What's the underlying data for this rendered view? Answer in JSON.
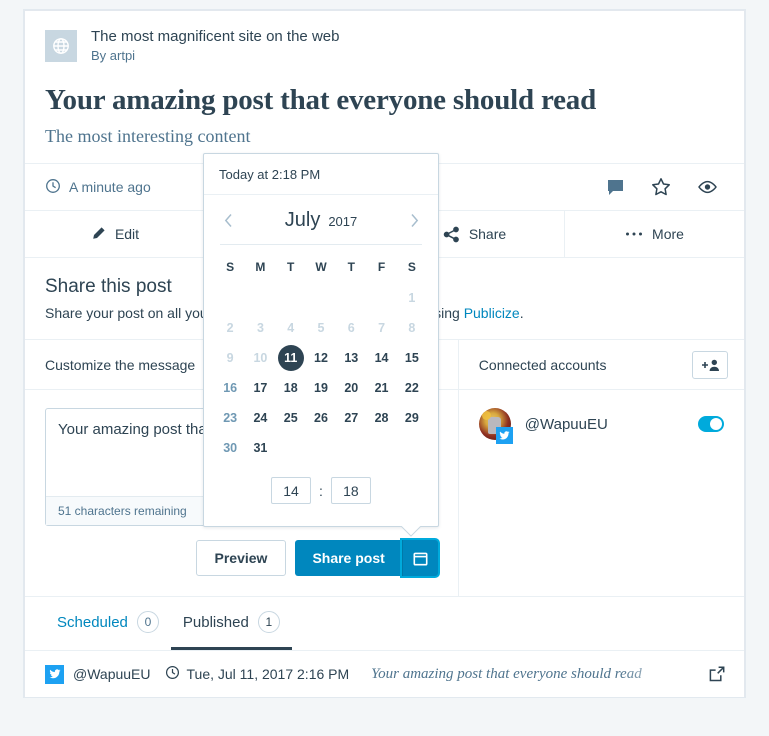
{
  "site": {
    "icon": "globe-icon",
    "title": "The most magnificent site on the web",
    "author": "By artpi"
  },
  "post": {
    "title": "Your amazing post that everyone should read",
    "excerpt": "The most interesting content",
    "time_label": "A minute ago",
    "meta_icons": [
      "comment-icon",
      "star-icon",
      "eye-icon"
    ]
  },
  "actions": [
    {
      "label": "Edit",
      "icon": "pencil-icon"
    },
    {
      "label": "",
      "icon": ""
    },
    {
      "label": "Share",
      "icon": "share-icon"
    },
    {
      "label": "More",
      "icon": "ellipsis-icon"
    }
  ],
  "share": {
    "heading": "Share this post",
    "description_before": "Share your post on all your connected social media accounts using ",
    "link_label": "Publicize",
    "description_after": ".",
    "customize_label": "Customize the message",
    "message_value": "Your amazing post that everyone should read",
    "characters_remaining": "51 characters remaining",
    "preview_label": "Preview",
    "share_post_label": "Share post",
    "calendar_button_icon": "calendar-icon"
  },
  "accounts": {
    "heading": "Connected accounts",
    "add_button_icon": "add-user-icon",
    "list": [
      {
        "handle": "@WapuuEU",
        "service": "twitter-icon",
        "enabled": true
      }
    ]
  },
  "calendar": {
    "today_label": "Today at 2:18 PM",
    "prev_icon": "chevron-left-icon",
    "next_icon": "chevron-right-icon",
    "month": "July",
    "year": "2017",
    "dow": [
      "S",
      "M",
      "T",
      "W",
      "T",
      "F",
      "S"
    ],
    "weeks": [
      [
        {
          "d": "",
          "state": "empty"
        },
        {
          "d": "",
          "state": "empty"
        },
        {
          "d": "",
          "state": "empty"
        },
        {
          "d": "",
          "state": "empty"
        },
        {
          "d": "",
          "state": "empty"
        },
        {
          "d": "",
          "state": "empty"
        },
        {
          "d": "1",
          "state": "muted"
        }
      ],
      [
        {
          "d": "2",
          "state": "muted"
        },
        {
          "d": "3",
          "state": "muted"
        },
        {
          "d": "4",
          "state": "muted"
        },
        {
          "d": "5",
          "state": "muted"
        },
        {
          "d": "6",
          "state": "muted"
        },
        {
          "d": "7",
          "state": "muted"
        },
        {
          "d": "8",
          "state": "muted"
        }
      ],
      [
        {
          "d": "9",
          "state": "muted"
        },
        {
          "d": "10",
          "state": "muted"
        },
        {
          "d": "11",
          "state": "sel"
        },
        {
          "d": "12",
          "state": "normal"
        },
        {
          "d": "13",
          "state": "normal"
        },
        {
          "d": "14",
          "state": "normal"
        },
        {
          "d": "15",
          "state": "normal"
        }
      ],
      [
        {
          "d": "16",
          "state": "sun"
        },
        {
          "d": "17",
          "state": "normal"
        },
        {
          "d": "18",
          "state": "normal"
        },
        {
          "d": "19",
          "state": "normal"
        },
        {
          "d": "20",
          "state": "normal"
        },
        {
          "d": "21",
          "state": "normal"
        },
        {
          "d": "22",
          "state": "normal"
        }
      ],
      [
        {
          "d": "23",
          "state": "sun"
        },
        {
          "d": "24",
          "state": "normal"
        },
        {
          "d": "25",
          "state": "normal"
        },
        {
          "d": "26",
          "state": "normal"
        },
        {
          "d": "27",
          "state": "normal"
        },
        {
          "d": "28",
          "state": "normal"
        },
        {
          "d": "29",
          "state": "normal"
        }
      ],
      [
        {
          "d": "30",
          "state": "sun"
        },
        {
          "d": "31",
          "state": "normal"
        },
        {
          "d": "",
          "state": "empty"
        },
        {
          "d": "",
          "state": "empty"
        },
        {
          "d": "",
          "state": "empty"
        },
        {
          "d": "",
          "state": "empty"
        },
        {
          "d": "",
          "state": "empty"
        }
      ]
    ],
    "hour": "14",
    "minute": "18",
    "time_separator": ":"
  },
  "tabs": [
    {
      "label": "Scheduled",
      "count": "0",
      "active": false
    },
    {
      "label": "Published",
      "count": "1",
      "active": true
    }
  ],
  "scheduled_row": {
    "service_icon": "twitter-icon",
    "handle": "@WapuuEU",
    "clock_icon": "clock-icon",
    "datetime": "Tue, Jul 11, 2017 2:16 PM",
    "message": "Your amazing post that everyone should read",
    "external_icon": "external-link-icon"
  },
  "colors": {
    "accent": "#0087be",
    "accent_light": "#00aadc",
    "twitter": "#1da1f2",
    "text_dark": "#2e4453",
    "text_muted": "#4f748e",
    "border": "#c8d7e1",
    "page_bg": "#f3f6f8"
  }
}
